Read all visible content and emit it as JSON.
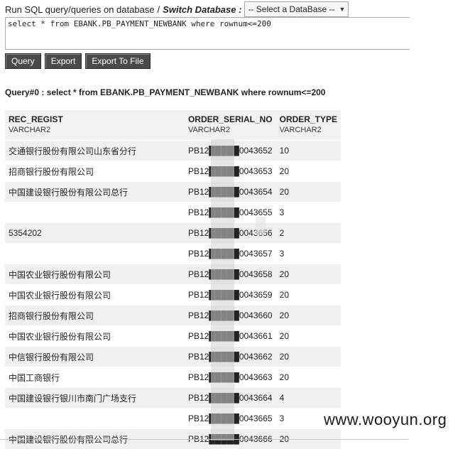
{
  "header": {
    "prefix": "Run SQL query/queries on database",
    "sep": "/",
    "switch_label": "Switch Database :",
    "db_select_value": "-- Select a DataBase --"
  },
  "query_input": {
    "value": "select * from EBANK.PB_PAYMENT_NEWBANK where rownum<=200"
  },
  "buttons": {
    "query": "Query",
    "export": "Export",
    "export_file": "Export To File"
  },
  "result": {
    "title": "Query#0 : select * from EBANK.PB_PAYMENT_NEWBANK where rownum<=200",
    "columns": [
      {
        "name": "REC_REGIST",
        "type": "VARCHAR2"
      },
      {
        "name": "ORDER_SERIAL_NO",
        "type": "VARCHAR2"
      },
      {
        "name": "ORDER_TYPE",
        "type": "VARCHAR2"
      }
    ],
    "rows": [
      [
        "交通银行股份有限公司山东省分行",
        "PB12█████0043652",
        "10"
      ],
      [
        "招商银行股份有限公司",
        "PB12█████0043653",
        "20"
      ],
      [
        "中国建设银行股份有限公司总行",
        "PB12█████0043654",
        "20"
      ],
      [
        "",
        "PB12█████0043655",
        "3"
      ],
      [
        "5354202",
        "PB12█████0043656",
        "2"
      ],
      [
        "",
        "PB12█████0043657",
        "3"
      ],
      [
        "中国农业银行股份有限公司",
        "PB12█████0043658",
        "20"
      ],
      [
        "中国农业银行股份有限公司",
        "PB12█████0043659",
        "20"
      ],
      [
        "招商银行股份有限公司",
        "PB12█████0043660",
        "20"
      ],
      [
        "中国农业银行股份有限公司",
        "PB12█████0043661",
        "20"
      ],
      [
        "中信银行股份有限公司",
        "PB12█████0043662",
        "20"
      ],
      [
        "中国工商银行",
        "PB12█████0043663",
        "20"
      ],
      [
        "中国建设银行银川市南门广场支行",
        "PB12█████0043664",
        "4"
      ],
      [
        "",
        "PB12█████0043665",
        "3"
      ],
      [
        "中国建设银行股份有限公司总行",
        "PB12█████0043666",
        "20"
      ]
    ]
  },
  "watermark": "www.wooyun.org"
}
